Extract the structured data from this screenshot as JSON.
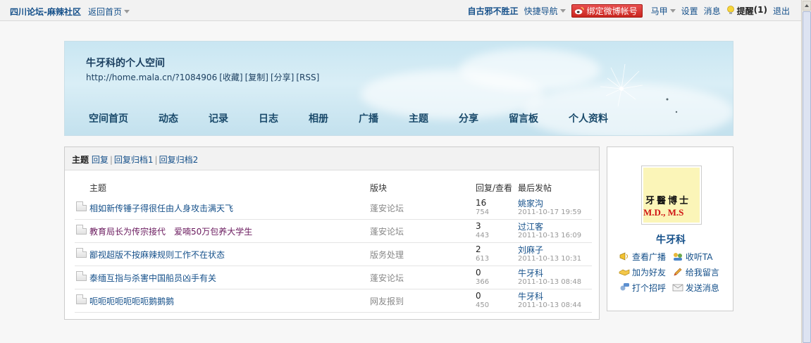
{
  "topbar": {
    "site_name": "四川论坛-麻辣社区",
    "back_home": "返回首页",
    "slogan": "自古邪不胜正",
    "quick_nav": "快捷导航",
    "weibo_bind": "绑定微博帐号",
    "user": "马甲",
    "settings": "设置",
    "messages": "消息",
    "remind": "提醒",
    "remind_count": "(1)",
    "logout": "退出"
  },
  "space": {
    "title": "牛牙科的个人空间",
    "url": "http://home.mala.cn/?1084906",
    "actions": [
      "[收藏]",
      "[复制]",
      "[分享]",
      "[RSS]"
    ],
    "nav": [
      "空间首页",
      "动态",
      "记录",
      "日志",
      "相册",
      "广播",
      "主题",
      "分享",
      "留言板",
      "个人资料"
    ]
  },
  "tabs": {
    "active": "主题",
    "items": [
      "回复",
      "回复归档1",
      "回复归档2"
    ]
  },
  "table": {
    "headers": {
      "subject": "主题",
      "forum": "版块",
      "reply_view": "回复/查看",
      "last_post": "最后发帖"
    },
    "rows": [
      {
        "subject": "相如新传锤子得很任由人身攻击满天飞",
        "visited": false,
        "forum": "蓬安论坛",
        "replies": "16",
        "views": "754",
        "last_user": "姚家沟",
        "last_time": "2011-10-17 19:59"
      },
      {
        "subject": "教育局长为传宗接代　爱喃50万包养大学生",
        "visited": true,
        "forum": "蓬安论坛",
        "replies": "3",
        "views": "443",
        "last_user": "过江客",
        "last_time": "2011-10-13 16:09"
      },
      {
        "subject": "鄙视超版不按麻辣规则工作不在状态",
        "visited": false,
        "forum": "版务处理",
        "replies": "2",
        "views": "613",
        "last_user": "刘麻子",
        "last_time": "2011-10-13 10:31"
      },
      {
        "subject": "泰缅互指与杀害中国船员凶手有关",
        "visited": false,
        "forum": "蓬安论坛",
        "replies": "0",
        "views": "366",
        "last_user": "牛牙科",
        "last_time": "2011-10-13 08:48"
      },
      {
        "subject": "呃呃呃呃呃呃呃鹅鹅鹅",
        "visited": false,
        "forum": "网友报到",
        "replies": "0",
        "views": "450",
        "last_user": "牛牙科",
        "last_time": "2011-10-13 08:44"
      }
    ]
  },
  "profile": {
    "avatar_cn": "牙醫博士",
    "avatar_en": "M.D., M.S",
    "name": "牛牙科",
    "links": {
      "view_broadcast": "查看广播",
      "listen_ta": "收听TA",
      "add_friend": "加为好友",
      "leave_message": "给我留言",
      "greet": "打个招呼",
      "send_message": "发送消息"
    }
  },
  "colors": {
    "link": "#15508a",
    "visited": "#6a1a5e",
    "weibo": "#d6322b"
  }
}
